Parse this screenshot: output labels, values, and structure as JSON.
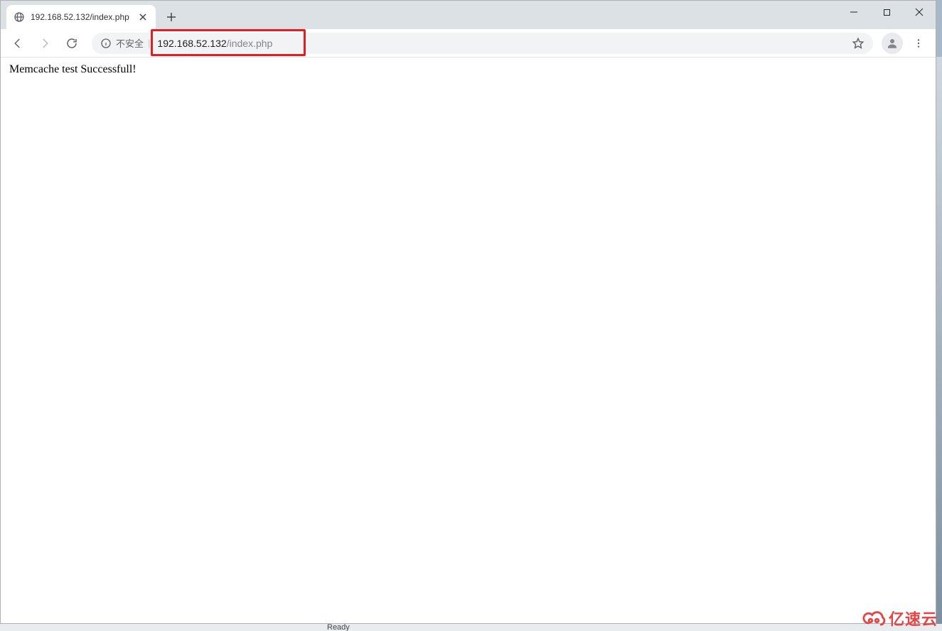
{
  "tab": {
    "title": "192.168.52.132/index.php"
  },
  "omnibox": {
    "insecure_label": "不安全",
    "url_host": "192.168.52.132",
    "url_path": "/index.php"
  },
  "page": {
    "body_text": "Memcache test Successfull!"
  },
  "status": {
    "text": "Ready"
  },
  "watermark": {
    "text": "亿速云"
  },
  "annotation": {
    "highlight_color": "#e02020"
  }
}
